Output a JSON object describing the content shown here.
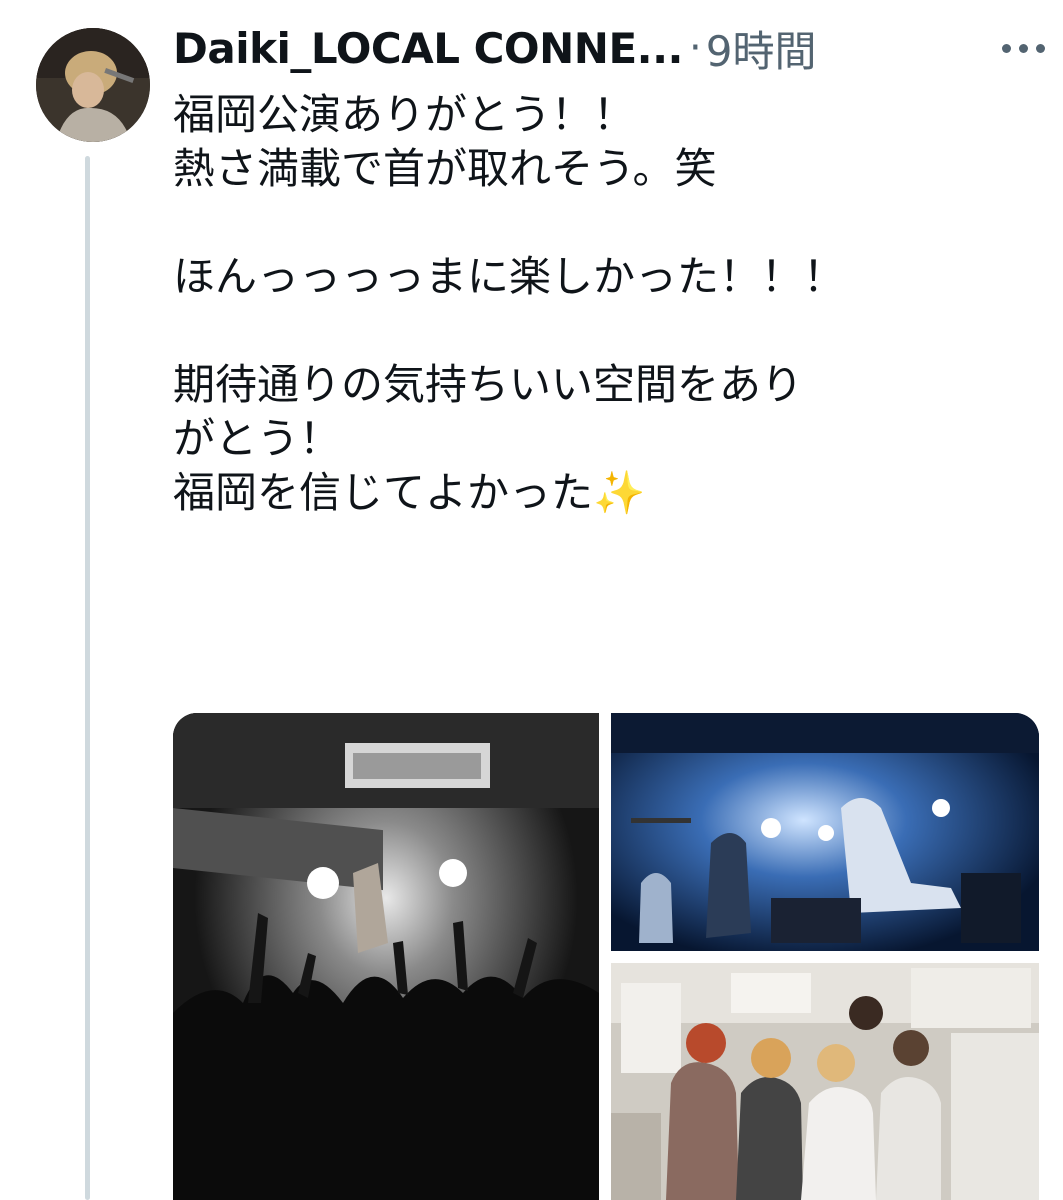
{
  "tweet": {
    "author": {
      "display_name": "Daiki_LOCAL CONNE...",
      "avatar_icon": "user-avatar"
    },
    "separator": "·",
    "timestamp": "9時間",
    "more_icon": "more-horizontal-icon",
    "text_lines": [
      "福岡公演ありがとう！！",
      "熱さ満載で首が取れそう。笑",
      "",
      "ほんっっっっまに楽しかった！！！",
      "",
      "期待通りの気持ちいい空間をあり",
      "がとう！",
      "福岡を信じてよかった✨"
    ],
    "media": [
      {
        "name": "photo-crowd",
        "alt": "concert-crowd-photo"
      },
      {
        "name": "photo-stage",
        "alt": "band-on-stage-photo"
      },
      {
        "name": "photo-group",
        "alt": "band-group-backstage-photo"
      }
    ]
  },
  "colors": {
    "text_primary": "#0f1419",
    "text_secondary": "#536471",
    "thread_line": "#cfd9de",
    "background": "#ffffff"
  }
}
